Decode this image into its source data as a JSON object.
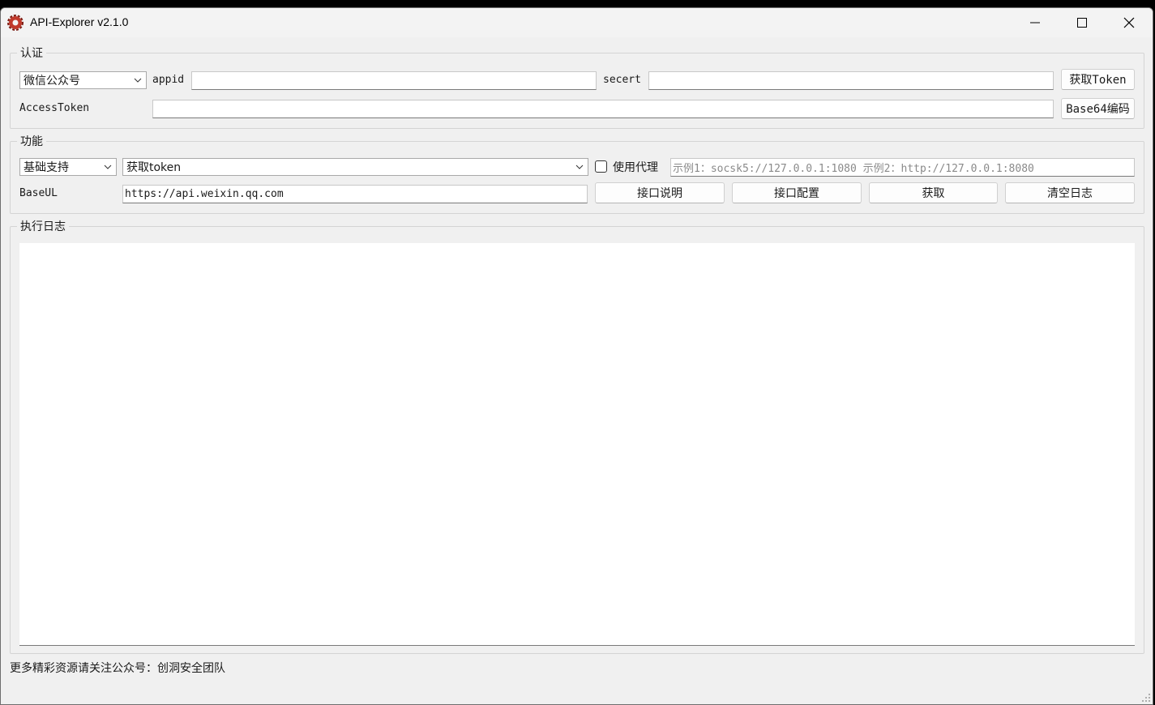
{
  "window": {
    "title": "API-Explorer v2.1.0",
    "icon": "gear-icon",
    "controls": [
      "minimize-icon",
      "maximize-icon",
      "close-icon"
    ]
  },
  "auth": {
    "group_title": "认证",
    "platform_select": "微信公众号",
    "appid_label": "appid",
    "appid_value": "",
    "secret_label": "secert",
    "secret_value": "",
    "get_token_button": "获取Token",
    "access_token_label": "AccessToken",
    "access_token_value": "",
    "base64_button": "Base64编码"
  },
  "function": {
    "group_title": "功能",
    "category_select": "基础支持",
    "api_select": "获取token",
    "proxy_checkbox_label": "使用代理",
    "proxy_checked": false,
    "proxy_placeholder": "示例1：socsk5://127.0.0.1:1080 示例2：http://127.0.0.1:8080",
    "base_url_label": "BaseUL",
    "base_url_value": "https://api.weixin.qq.com",
    "buttons": {
      "api_doc": "接口说明",
      "api_config": "接口配置",
      "fetch": "获取",
      "clear_log": "清空日志"
    }
  },
  "log": {
    "group_title": "执行日志",
    "content": ""
  },
  "footer": {
    "text": "更多精彩资源请关注公众号：创洞安全团队"
  }
}
